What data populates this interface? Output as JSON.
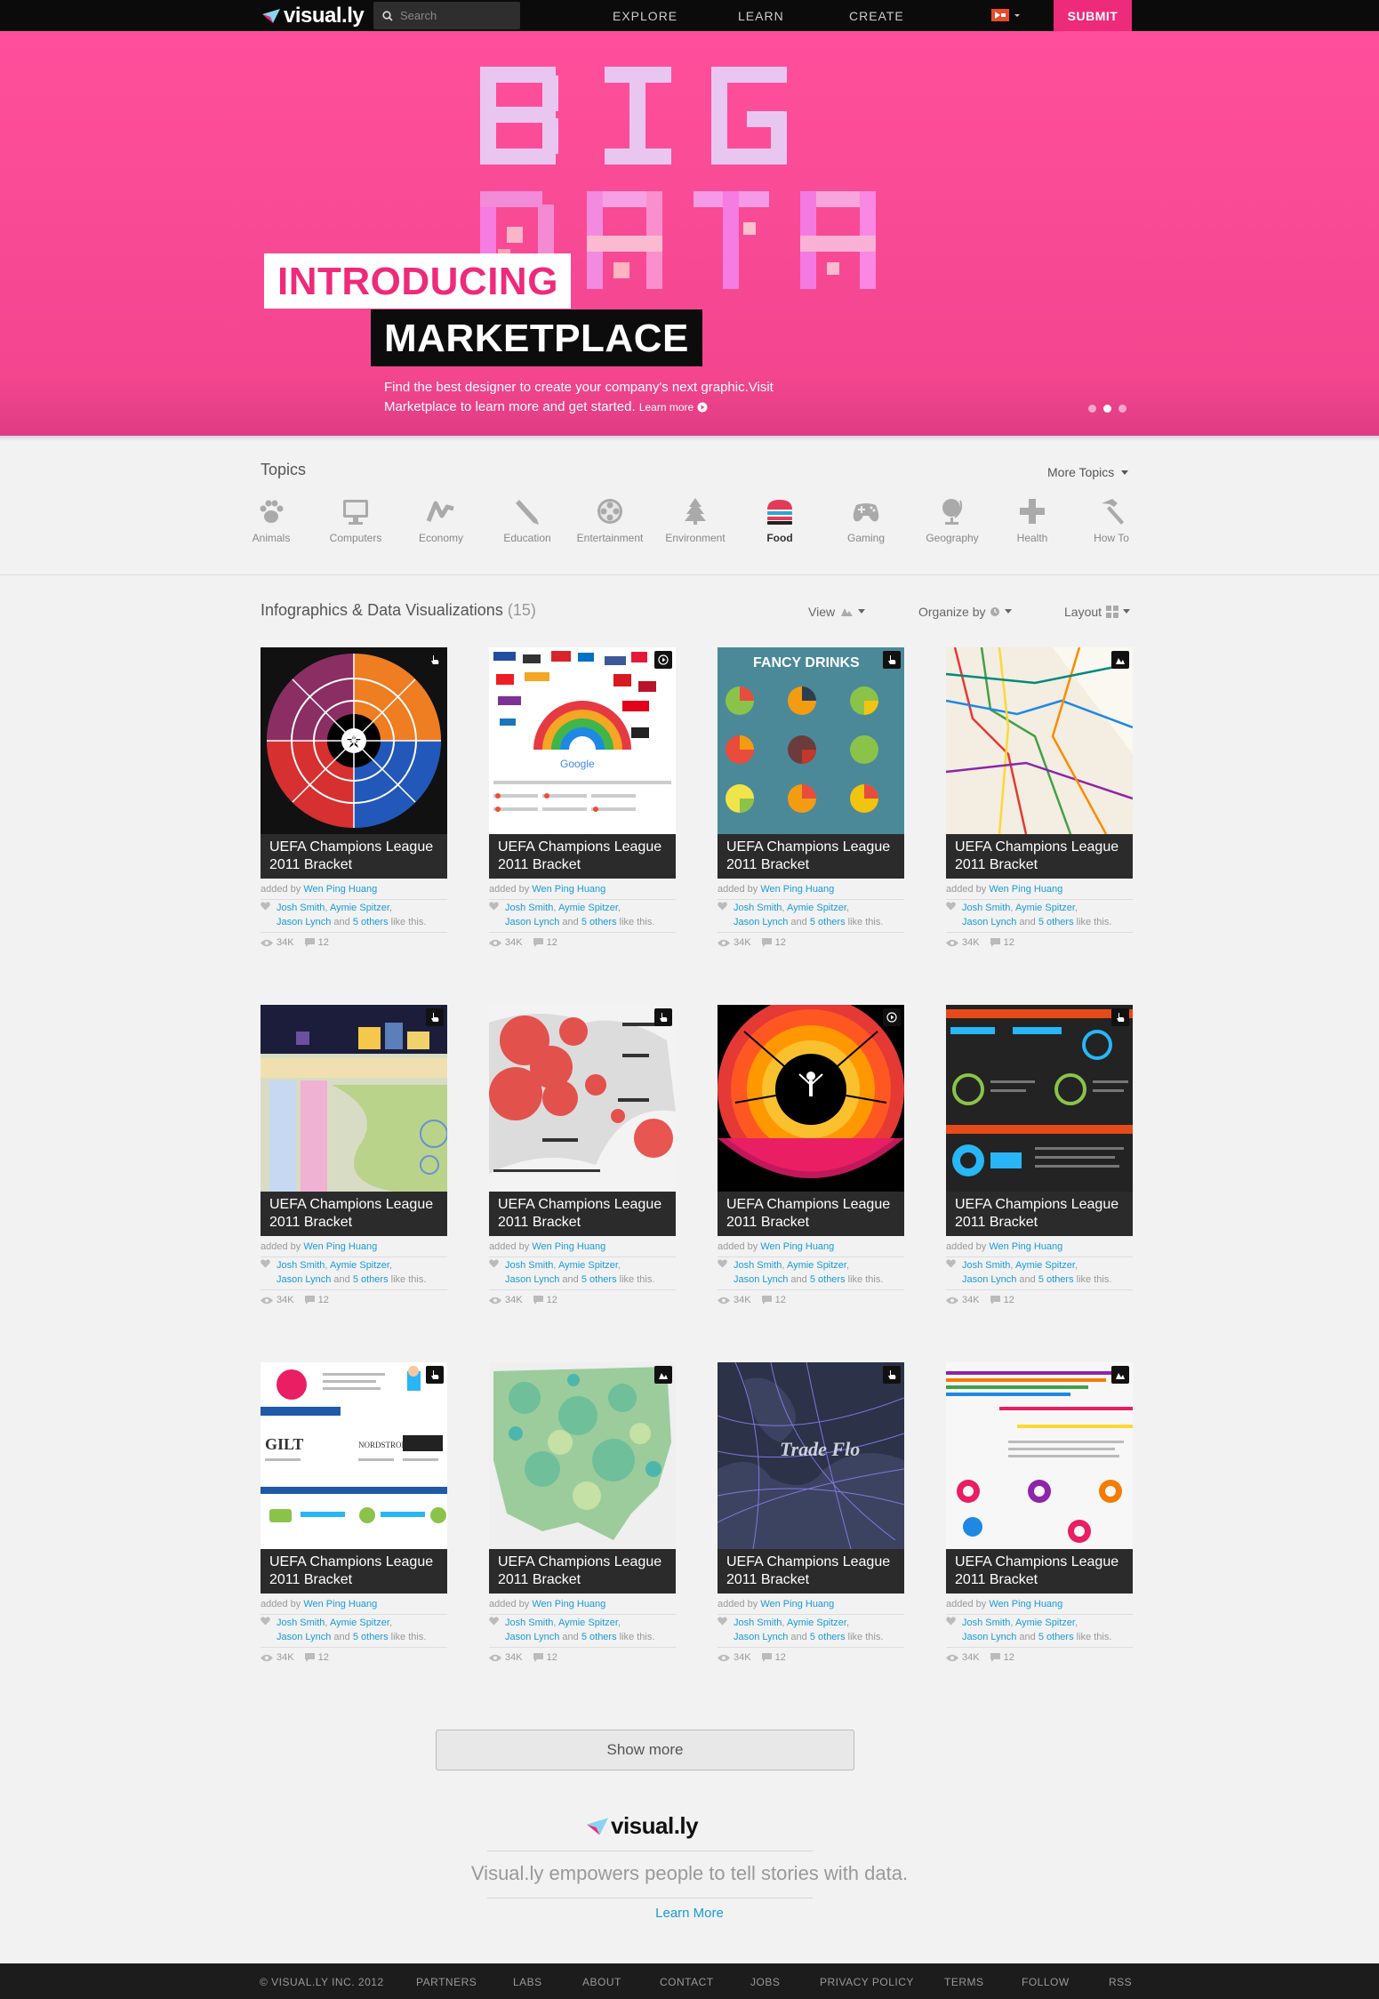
{
  "nav": {
    "logo": "visual.ly",
    "search_placeholder": "Search",
    "links": [
      "EXPLORE",
      "LEARN",
      "CREATE"
    ],
    "submit": "SUBMIT"
  },
  "hero": {
    "art_line1": "BIG",
    "art_line2": "DATA",
    "introducing": "INTRODUCING",
    "marketplace": "MARKETPLACE",
    "text": "Find the best designer to create your company's next graphic.Visit Marketplace to learn more and get started.",
    "learn_more": "Learn more",
    "slides": 3,
    "active_slide": 2
  },
  "topics": {
    "title": "Topics",
    "more": "More Topics",
    "items": [
      {
        "label": "Animals",
        "icon": "paw-icon"
      },
      {
        "label": "Computers",
        "icon": "monitor-icon"
      },
      {
        "label": "Economy",
        "icon": "chart-line-icon"
      },
      {
        "label": "Education",
        "icon": "pencil-icon"
      },
      {
        "label": "Entertainment",
        "icon": "film-reel-icon"
      },
      {
        "label": "Environment",
        "icon": "tree-icon"
      },
      {
        "label": "Food",
        "icon": "burger-icon"
      },
      {
        "label": "Gaming",
        "icon": "gamepad-icon"
      },
      {
        "label": "Geography",
        "icon": "globe-icon"
      },
      {
        "label": "Health",
        "icon": "plus-icon"
      },
      {
        "label": "How To",
        "icon": "hammer-icon"
      }
    ],
    "active": "Food"
  },
  "section": {
    "title": "Infographics & Data Visualizations",
    "count": "(15)",
    "view": "View",
    "organize": "Organize by",
    "layout": "Layout"
  },
  "card": {
    "title_line1": "UEFA Champions League",
    "title_line2": "2011 Bracket",
    "added_by": "added by",
    "author": "Wen Ping Huang",
    "liker1": "Josh Smith",
    "liker2": "Aymie Spitzer",
    "liker3": "Jason Lynch",
    "and": "and",
    "others": "5 others",
    "like_this": "like this.",
    "views": "34K",
    "comments": "12"
  },
  "showmore": "Show more",
  "footer": {
    "logo": "visual.ly",
    "tagline": "Visual.ly empowers people to tell stories with data.",
    "learn_more": "Learn More",
    "copyright": "© VISUAL.LY INC. 2012",
    "links": [
      "PARTNERS",
      "LABS",
      "ABOUT",
      "CONTACT",
      "JOBS",
      "PRIVACY POLICY",
      "TERMS",
      "FOLLOW",
      "RSS"
    ]
  },
  "colors": {
    "brand_pink": "#ee2a7b",
    "hero_pink": "#ff4f9c",
    "link_blue": "#1a9bd7",
    "food_icon": "#e43a5a"
  }
}
